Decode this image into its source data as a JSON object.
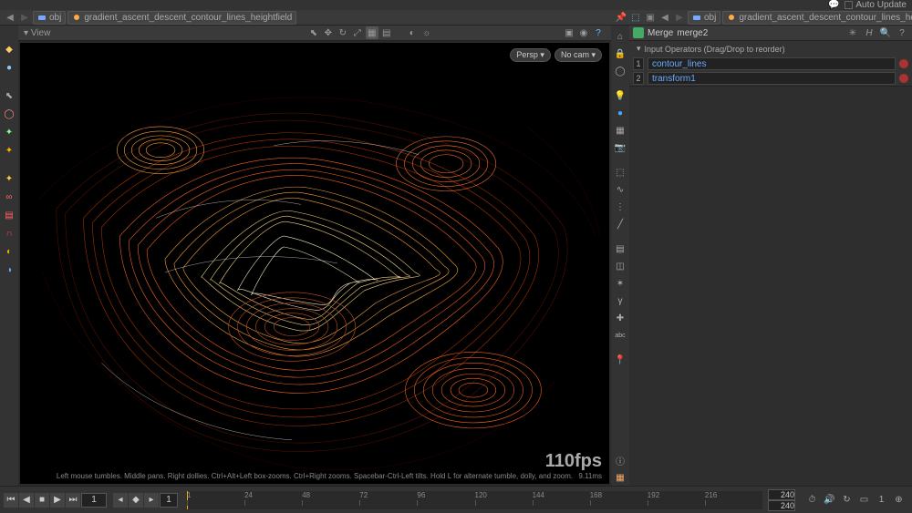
{
  "topbar": {
    "auto_update": "Auto Update"
  },
  "breadcrumb": {
    "obj": "obj",
    "node": "gradient_ascent_descent_contour_lines_heightfield"
  },
  "viewport": {
    "dropdown_label": "View",
    "persp": "Persp",
    "cam": "No cam",
    "fps": "110fps",
    "frametime": "9.11ms",
    "hint": "Left mouse tumbles. Middle pans. Right dollies. Ctrl+Alt+Left box-zooms. Ctrl+Right zooms. Spacebar-Ctrl-Left tilts. Hold L for alternate tumble, dolly, and zoom."
  },
  "node_panel": {
    "type": "Merge",
    "name": "merge2",
    "section_label": "Input Operators (Drag/Drop to reorder)",
    "inputs": [
      "contour_lines",
      "transform1"
    ],
    "row_nums": [
      "1",
      "2"
    ]
  },
  "timeline": {
    "current_frame": "1",
    "cache_frame": "1",
    "ticks": [
      "1",
      "24",
      "48",
      "72",
      "96",
      "120",
      "144",
      "168",
      "192",
      "216"
    ],
    "end1": "240",
    "end2": "240"
  }
}
